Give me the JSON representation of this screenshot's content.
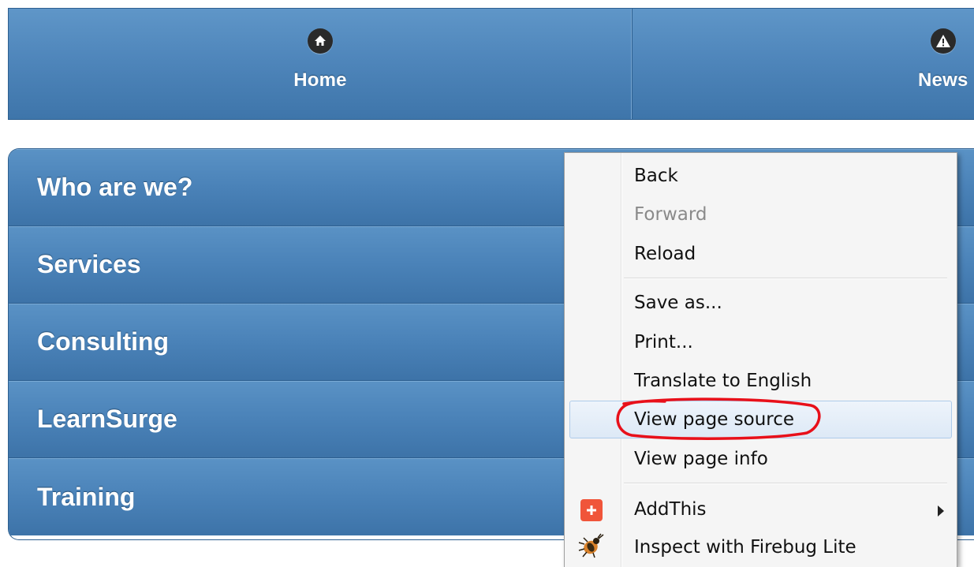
{
  "nav": {
    "items": [
      {
        "label": "Home",
        "icon": "home-icon"
      },
      {
        "label": "News",
        "icon": "alert-icon"
      }
    ]
  },
  "menu": {
    "items": [
      {
        "label": "Who are we?"
      },
      {
        "label": "Services"
      },
      {
        "label": "Consulting"
      },
      {
        "label": "LearnSurge"
      },
      {
        "label": "Training"
      }
    ]
  },
  "context_menu": {
    "items": [
      {
        "label": "Back",
        "enabled": true
      },
      {
        "label": "Forward",
        "enabled": false
      },
      {
        "label": "Reload",
        "enabled": true
      },
      {
        "label": "Save as...",
        "enabled": true
      },
      {
        "label": "Print...",
        "enabled": true
      },
      {
        "label": "Translate to English",
        "enabled": true
      },
      {
        "label": "View page source",
        "enabled": true,
        "highlighted": true
      },
      {
        "label": "View page info",
        "enabled": true
      },
      {
        "label": "AddThis",
        "enabled": true,
        "icon": "addthis-icon",
        "has_submenu": true
      },
      {
        "label": "Inspect with Firebug Lite",
        "enabled": true,
        "icon": "firebug-icon"
      }
    ]
  },
  "colors": {
    "nav_blue": "#4f86bb",
    "highlight_circle": "#e8101a",
    "addthis_red": "#f0553a"
  }
}
